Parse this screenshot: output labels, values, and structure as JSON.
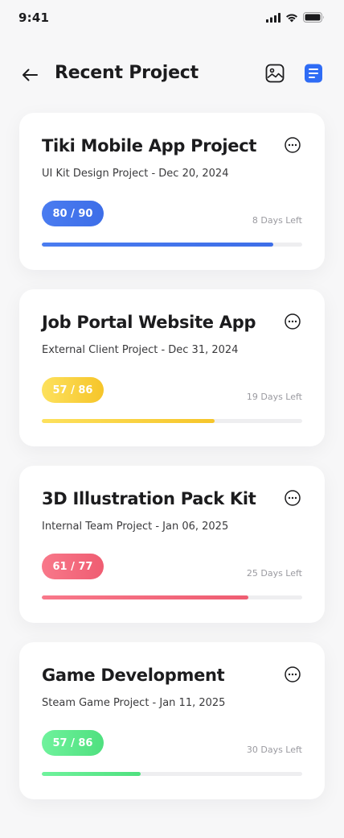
{
  "status": {
    "time": "9:41"
  },
  "header": {
    "title": "Recent Project"
  },
  "projects": [
    {
      "title": "Tiki Mobile App Project",
      "subtitle": "UI Kit Design Project - Dec 20, 2024",
      "progress_label": "80 / 90",
      "done": 80,
      "total": 90,
      "days_left": "8 Days Left",
      "color_from": "#4a7cf0",
      "color_to": "#3d6ee8"
    },
    {
      "title": "Job Portal Website App",
      "subtitle": "External Client Project - Dec 31, 2024",
      "progress_label": "57 / 86",
      "done": 57,
      "total": 86,
      "days_left": "19 Days Left",
      "color_from": "#fde15d",
      "color_to": "#f6c52a"
    },
    {
      "title": "3D Illustration Pack Kit",
      "subtitle": "Internal Team Project - Jan 06, 2025",
      "progress_label": "61 / 77",
      "done": 61,
      "total": 77,
      "days_left": "25 Days Left",
      "color_from": "#f8788a",
      "color_to": "#ef5d72"
    },
    {
      "title": "Game Development",
      "subtitle": "Steam Game Project - Jan 11, 2025",
      "progress_label": "57 / 86",
      "done": 57,
      "total": 86,
      "days_left": "30 Days Left",
      "progress_fraction": 0.38,
      "color_from": "#6ff29c",
      "color_to": "#4fe07f"
    }
  ],
  "icons": {
    "back": "arrow-left-icon",
    "image": "image-icon",
    "list": "list-icon",
    "more": "more-horizontal-icon"
  },
  "colors": {
    "accent": "#2f6cf5"
  }
}
